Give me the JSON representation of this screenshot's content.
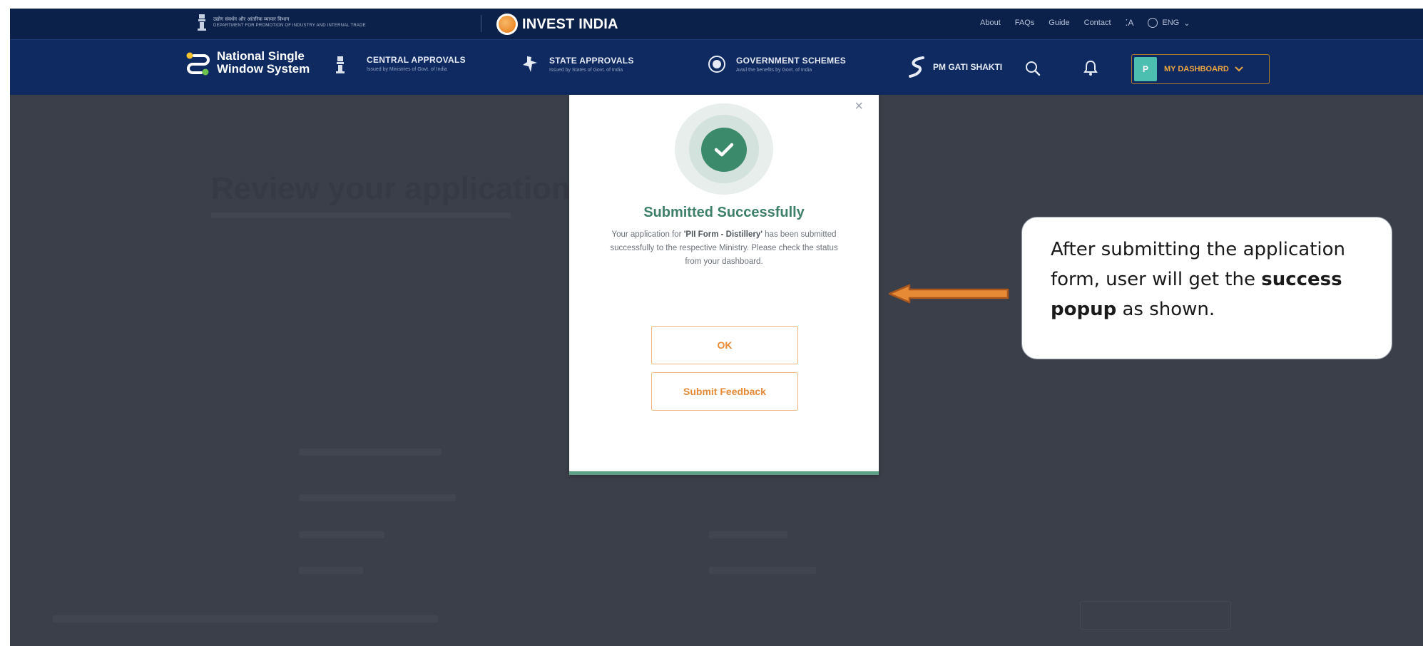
{
  "top_strip": {
    "dept_hindi": "उद्योग संवर्धन और आंतरिक व्यापार विभाग",
    "dept_english": "DEPARTMENT FOR PROMOTION OF INDUSTRY AND INTERNAL TRADE",
    "invest_india": "INVEST INDIA",
    "links": [
      "About",
      "FAQs",
      "Guide",
      "Contact"
    ],
    "text_size_icon": "A",
    "language": "ENG"
  },
  "navbar": {
    "brand_line1": "National Single",
    "brand_line2": "Window System",
    "items": [
      {
        "title": "CENTRAL APPROVALS",
        "subtitle": "Issued by Ministries of Govt. of India"
      },
      {
        "title": "STATE APPROVALS",
        "subtitle": "Issued by States of Govt. of India"
      },
      {
        "title": "GOVERNMENT SCHEMES",
        "subtitle": "Avail the benefits by Govt. of India"
      }
    ],
    "gati_shakti": "PM GATI SHAKTI",
    "avatar_initial": "P",
    "dashboard_label": "MY DASHBOARD"
  },
  "background": {
    "heading": "Review your application"
  },
  "modal": {
    "close": "×",
    "title": "Submitted Successfully",
    "message_prefix": "Your application for ",
    "message_form": "'PII Form - Distillery'",
    "message_suffix": " has been submitted successfully to the respective Ministry. Please check the status from your dashboard.",
    "ok_label": "OK",
    "feedback_label": "Submit Feedback"
  },
  "annotation": {
    "line1": "After submitting the application form, user will get the ",
    "bold": "success popup",
    "line2": " as shown."
  },
  "colors": {
    "navy_top": "#0c2149",
    "navy_nav": "#0e2a60",
    "accent_orange": "#e68a36",
    "success_green": "#3c8a6c",
    "overlay": "#3b3f49"
  }
}
